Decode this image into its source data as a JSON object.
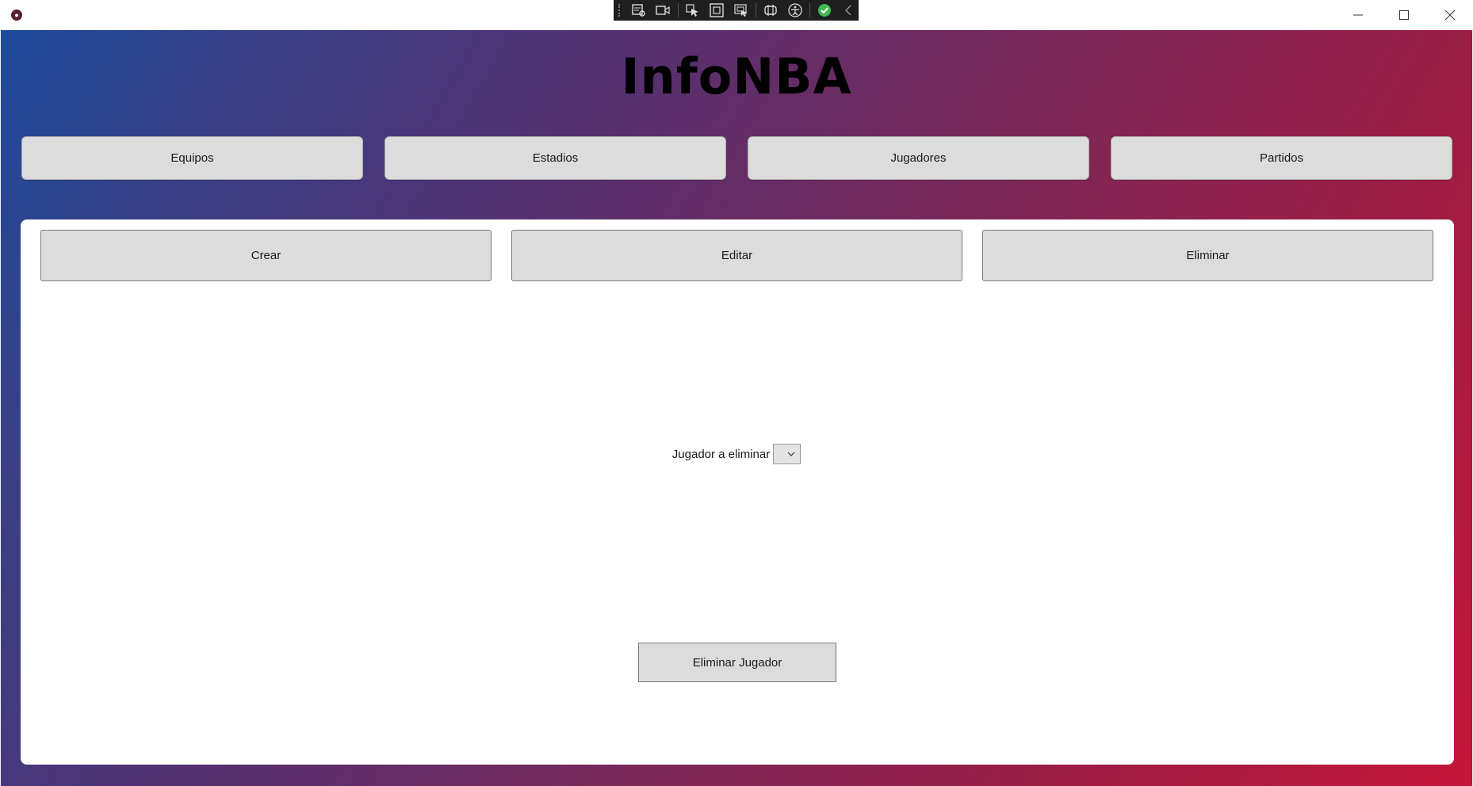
{
  "window": {
    "title": "",
    "controls": [
      "minimize-icon",
      "maximize-icon",
      "close-icon"
    ]
  },
  "debug_toolbar": {
    "icons": [
      "live-visual-tree-icon",
      "record-icon",
      "select-element-icon",
      "display-layout-adorners-icon",
      "track-focus-icon",
      "binding-failures-icon",
      "accessibility-icon",
      "check-icon",
      "collapse-chevron-icon"
    ]
  },
  "app": {
    "title": "InfoNBA"
  },
  "nav": {
    "items": [
      {
        "label": "Equipos"
      },
      {
        "label": "Estadios"
      },
      {
        "label": "Jugadores"
      },
      {
        "label": "Partidos"
      }
    ]
  },
  "actions": {
    "items": [
      {
        "label": "Crear"
      },
      {
        "label": "Editar"
      },
      {
        "label": "Eliminar"
      }
    ]
  },
  "form": {
    "player_label": "Jugador a eliminar",
    "player_selected": "",
    "submit_label": "Eliminar Jugador"
  },
  "colors": {
    "gradient_start": "#1c4a9a",
    "gradient_end": "#c4163a",
    "button_bg": "#dcdcdc",
    "panel_bg": "#ffffff"
  }
}
